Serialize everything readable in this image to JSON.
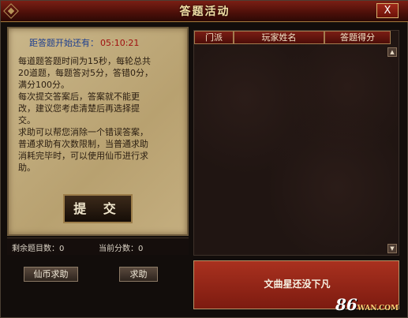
{
  "window": {
    "title": "答题活动",
    "close_label": "X"
  },
  "countdown": {
    "label": "距答题开始还有：",
    "time": "05:10:21"
  },
  "instructions": {
    "lines": [
      "每道题答题时间为15秒，每轮总共",
      "20道题，每题答对5分，答错0分，",
      "满分100分。",
      "每次提交答案后，答案就不能更",
      "改，建议您考虑清楚后再选择提",
      "交。",
      "求助可以帮您消除一个错误答案，",
      "普通求助有次数限制，当普通求助",
      "消耗完毕时，可以使用仙币进行求",
      "助。"
    ]
  },
  "buttons": {
    "submit": "提 交",
    "xianbi_help": "仙币求助",
    "help": "求助"
  },
  "status": {
    "remaining_label": "剩余题目数：",
    "remaining": "0",
    "score_label": "当前分数：",
    "score": "0"
  },
  "ranking_table": {
    "columns": [
      "门派",
      "玩家姓名",
      "答题得分"
    ],
    "rows": []
  },
  "notice": {
    "text": "文曲星还没下凡"
  },
  "branding": {
    "logo_text": "86",
    "logo_sub": "WAN.COM"
  }
}
